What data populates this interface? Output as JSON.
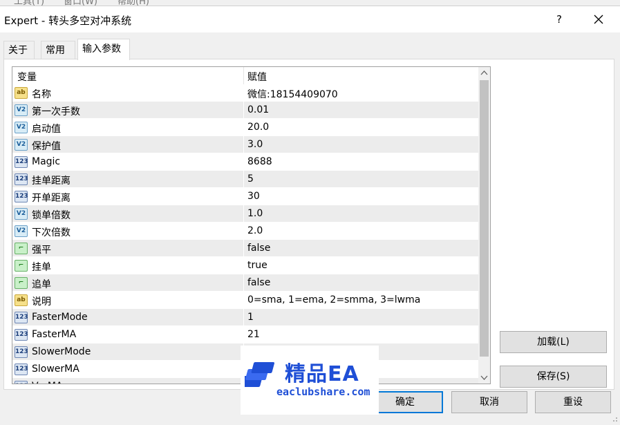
{
  "behind_menu": [
    "工具(T)",
    "窗口(W)",
    "帮助(H)"
  ],
  "window": {
    "title": "Expert - 转头多空对冲系统",
    "help_label": "?"
  },
  "tabs": [
    {
      "label": "关于",
      "active": false
    },
    {
      "label": "常用",
      "active": false
    },
    {
      "label": "输入参数",
      "active": true
    }
  ],
  "grid": {
    "col_variable": "变量",
    "col_value": "赋值",
    "rows": [
      {
        "type": "string",
        "icon": "ab",
        "name": "名称",
        "value": "微信:18154409070"
      },
      {
        "type": "double",
        "icon": "V2",
        "name": "第一次手数",
        "value": "0.01"
      },
      {
        "type": "double",
        "icon": "V2",
        "name": "启动值",
        "value": "20.0"
      },
      {
        "type": "double",
        "icon": "V2",
        "name": "保护值",
        "value": "3.0"
      },
      {
        "type": "int",
        "icon": "123",
        "name": "Magic",
        "value": "8688"
      },
      {
        "type": "int",
        "icon": "123",
        "name": "挂单距离",
        "value": "5"
      },
      {
        "type": "int",
        "icon": "123",
        "name": "开单距离",
        "value": "30"
      },
      {
        "type": "double",
        "icon": "V2",
        "name": "锁单倍数",
        "value": "1.0"
      },
      {
        "type": "double",
        "icon": "V2",
        "name": "下次倍数",
        "value": "2.0"
      },
      {
        "type": "bool",
        "icon": "⌐",
        "name": "强平",
        "value": "false"
      },
      {
        "type": "bool",
        "icon": "⌐",
        "name": "挂单",
        "value": "true"
      },
      {
        "type": "bool",
        "icon": "⌐",
        "name": "追单",
        "value": "false"
      },
      {
        "type": "string",
        "icon": "ab",
        "name": "说明",
        "value": "0=sma, 1=ema, 2=smma, 3=lwma"
      },
      {
        "type": "int",
        "icon": "123",
        "name": "FasterMode",
        "value": "1"
      },
      {
        "type": "int",
        "icon": "123",
        "name": "FasterMA",
        "value": "21"
      },
      {
        "type": "int",
        "icon": "123",
        "name": "SlowerMode",
        "value": ""
      },
      {
        "type": "int",
        "icon": "123",
        "name": "SlowerMA",
        "value": ""
      },
      {
        "type": "int",
        "icon": "123",
        "name": "VerMA",
        "value": ""
      }
    ]
  },
  "buttons": {
    "load": "加载(L)",
    "save": "保存(S)",
    "ok": "确定",
    "cancel": "取消",
    "reset": "重设"
  },
  "watermark": {
    "title": "精品EA",
    "url": "eaclubshare.com"
  },
  "colors": {
    "accent": "#0078d7",
    "watermark": "#1f4fd6"
  }
}
